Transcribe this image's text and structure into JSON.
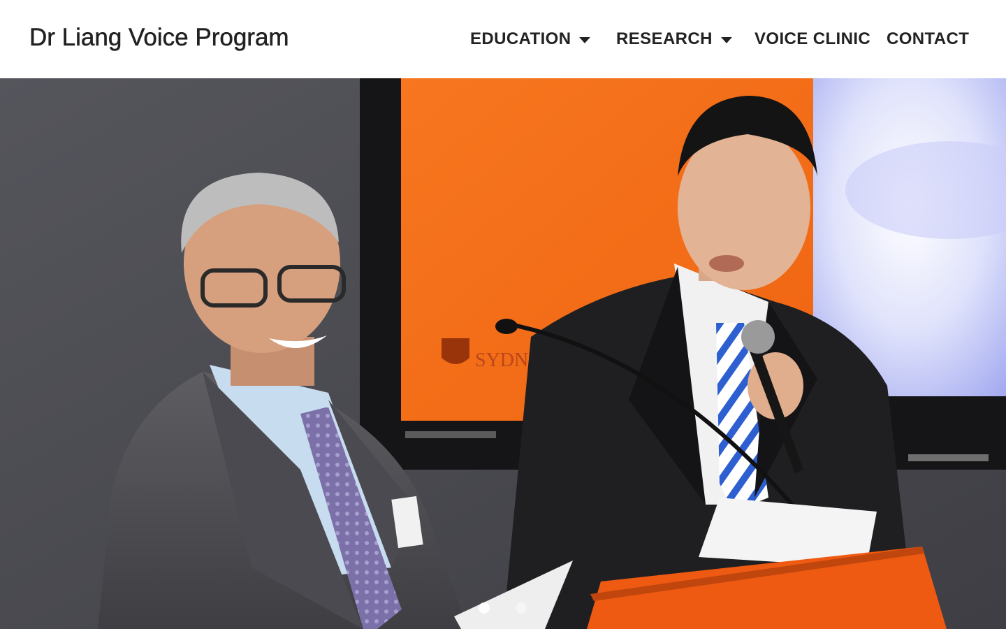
{
  "site": {
    "title": "Dr Liang Voice Program"
  },
  "nav": {
    "items": [
      {
        "label": "EDUCATION",
        "has_dropdown": true
      },
      {
        "label": "RESEARCH",
        "has_dropdown": true
      },
      {
        "label": "VOICE CLINIC",
        "has_dropdown": false
      },
      {
        "label": "CONTACT",
        "has_dropdown": false
      }
    ],
    "dropdown_icon": "caret-down-icon"
  },
  "hero": {
    "slide_count": 2,
    "active_slide": 1,
    "screen_logo_text": "SYDNEY"
  },
  "colors": {
    "text": "#222222",
    "header_bg": "#ffffff",
    "screen_orange": "#f36f1c",
    "podium_orange": "#ee5a12",
    "wall": "#4a4a50"
  }
}
